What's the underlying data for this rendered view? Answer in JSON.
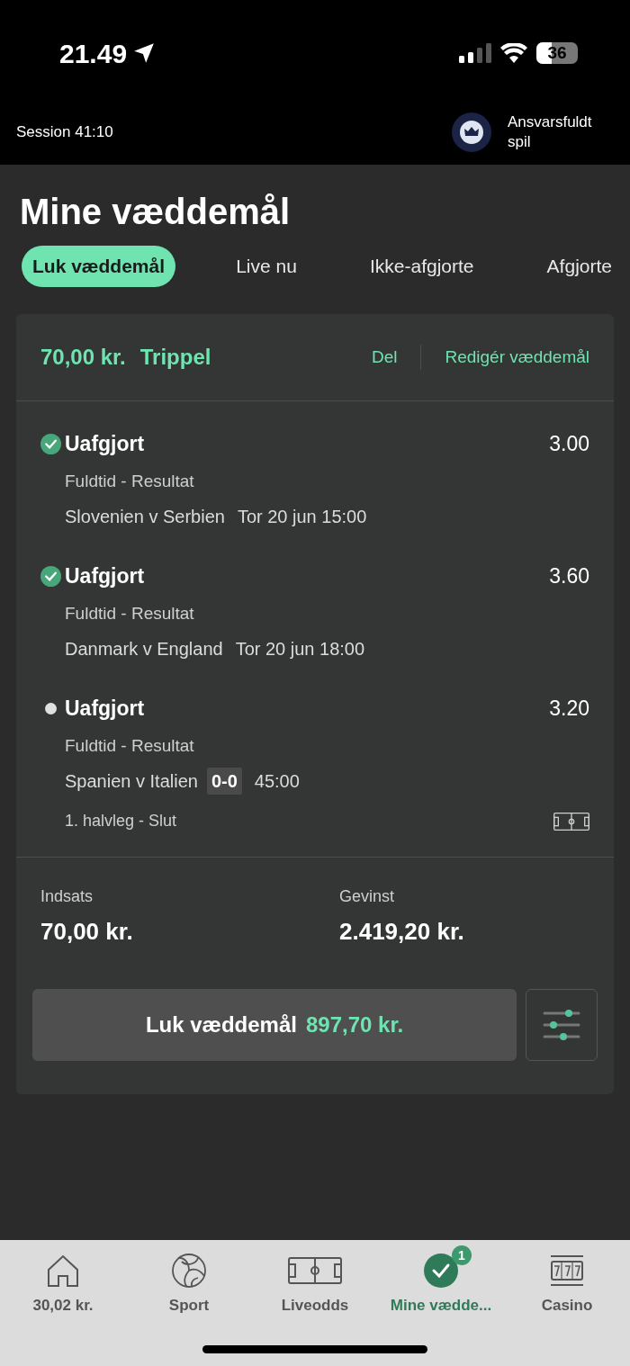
{
  "status_bar": {
    "time": "21.49",
    "battery": "36"
  },
  "header": {
    "session": "Session 41:10",
    "responsible": "Ansvarsfuldt spil"
  },
  "title": "Mine væddemål",
  "tabs": [
    {
      "label": "Luk væddemål",
      "selected": true
    },
    {
      "label": "Live nu",
      "selected": false
    },
    {
      "label": "Ikke-afgjorte",
      "selected": false
    },
    {
      "label": "Afgjorte",
      "selected": false
    }
  ],
  "bet": {
    "amount": "70,00 kr.",
    "type": "Trippel",
    "actions": [
      "Del",
      "Redigér væddemål"
    ],
    "selections": [
      {
        "kind": "won",
        "name": "Uafgjort",
        "odds": "3.00",
        "market": "Fuldtid - Resultat",
        "match": "Slovenien v Serbien",
        "time": "Tor 20 jun 15:00"
      },
      {
        "kind": "won",
        "name": "Uafgjort",
        "odds": "3.60",
        "market": "Fuldtid - Resultat",
        "match": "Danmark v England",
        "time": "Tor 20 jun 18:00"
      },
      {
        "kind": "live",
        "name": "Uafgjort",
        "odds": "3.20",
        "market": "Fuldtid - Resultat",
        "match": "Spanien v Italien",
        "score": "0-0",
        "time": "45:00",
        "period": "1. halvleg - Slut"
      }
    ],
    "stake": {
      "label": "Indsats",
      "value": "70,00 kr."
    },
    "win": {
      "label": "Gevinst",
      "value": "2.419,20 kr."
    },
    "cashout": {
      "label": "Luk væddemål",
      "amount": "897,70 kr."
    }
  },
  "nav": [
    {
      "kind": "home",
      "label": "30,02 kr.",
      "selected": false
    },
    {
      "kind": "sport",
      "label": "Sport",
      "selected": false
    },
    {
      "kind": "live",
      "label": "Liveodds",
      "selected": false
    },
    {
      "kind": "bets",
      "label": "Mine vædde...",
      "selected": true,
      "badge": "1"
    },
    {
      "kind": "casino",
      "label": "Casino",
      "selected": false
    }
  ]
}
